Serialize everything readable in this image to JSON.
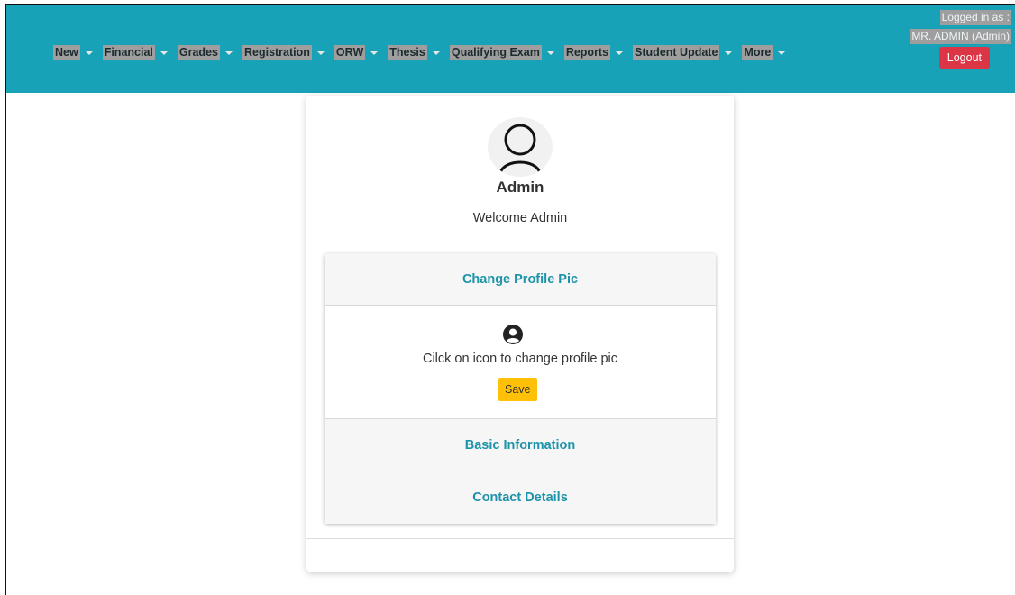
{
  "nav": {
    "items": [
      {
        "label": "New"
      },
      {
        "label": "Financial"
      },
      {
        "label": "Grades"
      },
      {
        "label": "Registration"
      },
      {
        "label": "ORW"
      },
      {
        "label": "Thesis"
      },
      {
        "label": "Qualifying Exam"
      },
      {
        "label": "Reports"
      },
      {
        "label": "Student Update"
      },
      {
        "label": "More"
      }
    ]
  },
  "user": {
    "logged_in_label": "Logged in as :",
    "name": "MR. ADMIN (Admin)",
    "logout_label": "Logout"
  },
  "profile": {
    "name": "Admin",
    "welcome": "Welcome Admin"
  },
  "accordion": {
    "change_pic_title": "Change Profile Pic",
    "change_pic_hint": "Cilck on icon to change profile pic",
    "save_label": "Save",
    "basic_info_title": "Basic Information",
    "contact_title": "Contact Details"
  },
  "colors": {
    "navbar": "#17a2b8",
    "logout": "#dc3545",
    "save": "#ffc107",
    "accent_text": "#1d93a9"
  },
  "icons": {
    "avatar": "user-outline-icon",
    "profile_pic": "user-circle-icon"
  }
}
